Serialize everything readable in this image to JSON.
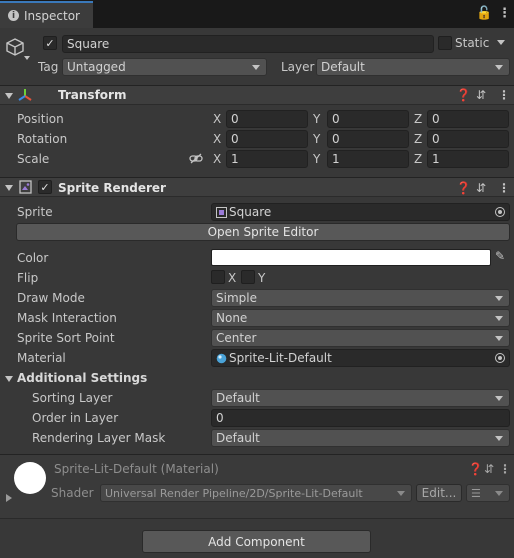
{
  "tab": {
    "title": "Inspector"
  },
  "object": {
    "name": "Square",
    "active": true,
    "static_label": "Static",
    "tag_label": "Tag",
    "tag_value": "Untagged",
    "layer_label": "Layer",
    "layer_value": "Default"
  },
  "transform": {
    "title": "Transform",
    "position": {
      "label": "Position",
      "x": "0",
      "y": "0",
      "z": "0"
    },
    "rotation": {
      "label": "Rotation",
      "x": "0",
      "y": "0",
      "z": "0"
    },
    "scale": {
      "label": "Scale",
      "x": "1",
      "y": "1",
      "z": "1"
    },
    "axis_x": "X",
    "axis_y": "Y",
    "axis_z": "Z"
  },
  "sprite_renderer": {
    "title": "Sprite Renderer",
    "enabled": true,
    "sprite_label": "Sprite",
    "sprite_value": "Square",
    "open_editor": "Open Sprite Editor",
    "color_label": "Color",
    "color_value": "#ffffff",
    "flip_label": "Flip",
    "flip_x": "X",
    "flip_y": "Y",
    "draw_mode_label": "Draw Mode",
    "draw_mode_value": "Simple",
    "mask_label": "Mask Interaction",
    "mask_value": "None",
    "sort_point_label": "Sprite Sort Point",
    "sort_point_value": "Center",
    "material_label": "Material",
    "material_value": "Sprite-Lit-Default",
    "additional_label": "Additional Settings",
    "sorting_layer_label": "Sorting Layer",
    "sorting_layer_value": "Default",
    "order_label": "Order in Layer",
    "order_value": "0",
    "rendering_mask_label": "Rendering Layer Mask",
    "rendering_mask_value": "Default"
  },
  "material": {
    "title": "Sprite-Lit-Default (Material)",
    "shader_label": "Shader",
    "shader_value": "Universal Render Pipeline/2D/Sprite-Lit-Default",
    "edit_label": "Edit..."
  },
  "add_component": "Add Component",
  "colors": {
    "tab_accent": "#3a79bb",
    "panel": "#383838",
    "field": "#2a2a2a"
  }
}
